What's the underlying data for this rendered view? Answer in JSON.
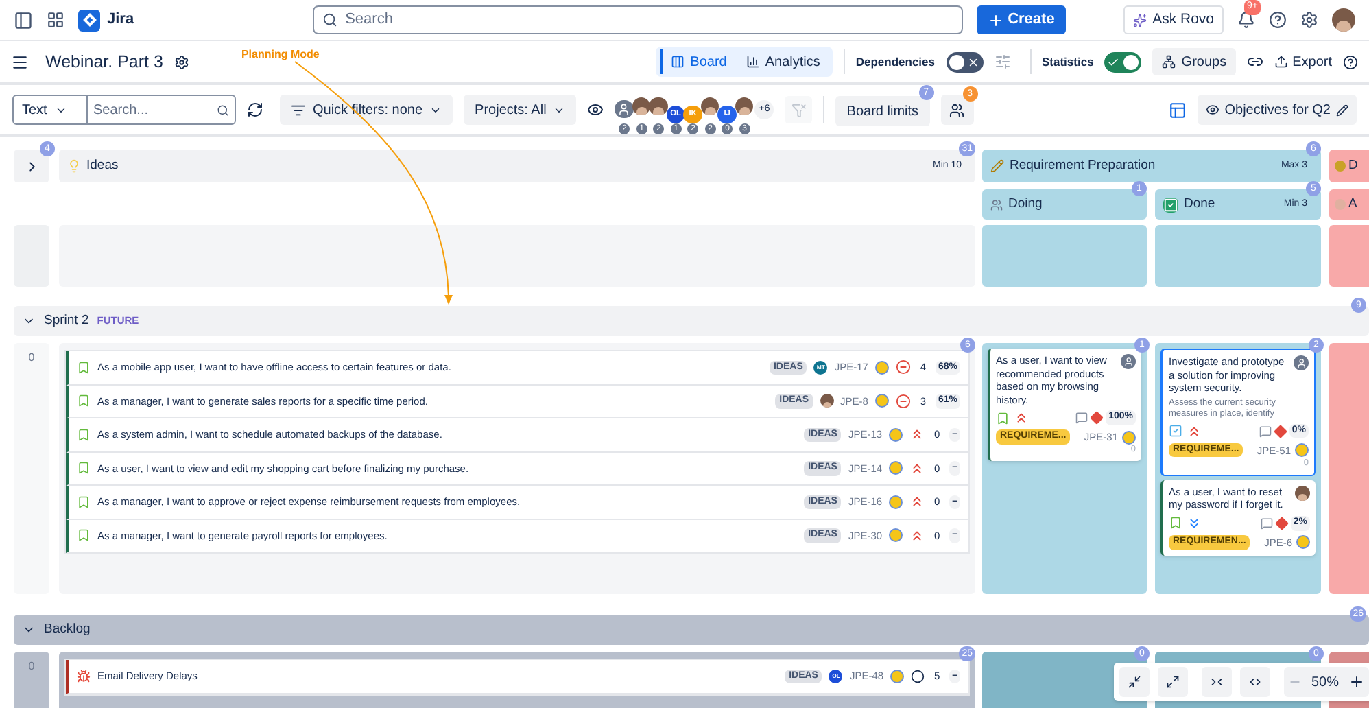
{
  "topbar": {
    "app_name": "Jira",
    "search": {
      "placeholder": "Search"
    },
    "create": "Create",
    "ask_rovo": "Ask Rovo",
    "notifications_badge": "9+"
  },
  "header": {
    "title": "Webinar. Part 3",
    "annotation": "Planning Mode",
    "view_tabs": [
      {
        "label": "Board",
        "selected": true
      },
      {
        "label": "Analytics",
        "selected": false
      }
    ],
    "dependencies": {
      "label": "Dependencies",
      "on": false
    },
    "statistics": {
      "label": "Statistics",
      "on": true
    },
    "groups": "Groups",
    "export": "Export"
  },
  "toolbar": {
    "search_mode": "Text",
    "search": {
      "placeholder": "Search..."
    },
    "quick_filters": "Quick filters: none",
    "projects": "Projects: All",
    "people": [
      {
        "kind": "generic",
        "count": "2"
      },
      {
        "kind": "photo",
        "count": "1"
      },
      {
        "kind": "photo",
        "count": "2"
      },
      {
        "kind": "initials",
        "initials": "OL",
        "color": "#1d4ed8",
        "count": "1"
      },
      {
        "kind": "initials",
        "initials": "IK",
        "color": "#f59e0b",
        "count": "2"
      },
      {
        "kind": "photo",
        "count": "2"
      },
      {
        "kind": "initials",
        "initials": "IJ",
        "color": "#2563eb",
        "count": "0"
      },
      {
        "kind": "photo",
        "count": "3"
      }
    ],
    "more_people": "+6",
    "board_limits": {
      "label": "Board limits",
      "badge": "7"
    },
    "team_badge": "3",
    "objectives": "Objectives for Q2"
  },
  "board": {
    "ideas": {
      "count_badge": "4",
      "title": "Ideas",
      "limit": "Min 10",
      "badge": "31"
    },
    "group": {
      "title": "Requirement Preparation",
      "limit": "Max 3",
      "badge": "6",
      "columns": [
        {
          "kind": "in_progress",
          "title": "Doing",
          "badge": "1"
        },
        {
          "kind": "done",
          "title": "Done",
          "limit": "Min 3",
          "badge": "5"
        }
      ]
    },
    "next_group": {
      "title": "D",
      "columns": [
        {
          "title": "A"
        }
      ]
    },
    "lanes": [
      {
        "kind": "sprint",
        "title": "Sprint 2",
        "state": "FUTURE",
        "expanded": true,
        "badge": "9",
        "row_count": "0",
        "list_badge": "6",
        "column_badges": [
          "1",
          "2"
        ],
        "issues": [
          {
            "kind": "story",
            "summary": "As a mobile app user, I want to have offline access to certain features or data.",
            "tag": "IDEAS",
            "assignee": {
              "kind": "initials",
              "initials": "MT",
              "color": "#0e7490"
            },
            "key": "JPE-17",
            "priority": {
              "kind": "blocker"
            },
            "points": "4",
            "progress": "68%"
          },
          {
            "kind": "story",
            "summary": "As a manager, I want to generate sales reports for a specific time period.",
            "tag": "IDEAS",
            "assignee": {
              "kind": "photo"
            },
            "key": "JPE-8",
            "priority": {
              "kind": "blocker"
            },
            "points": "3",
            "progress": "61%"
          },
          {
            "kind": "story",
            "summary": "As a system admin, I want to schedule automated backups of the database.",
            "tag": "IDEAS",
            "key": "JPE-13",
            "priority": {
              "kind": "highest"
            },
            "points": "0",
            "progress": "–"
          },
          {
            "kind": "story",
            "summary": "As a user, I want to view and edit my shopping cart before finalizing my purchase.",
            "tag": "IDEAS",
            "key": "JPE-14",
            "priority": {
              "kind": "highest"
            },
            "points": "0",
            "progress": "–"
          },
          {
            "kind": "story",
            "summary": "As a manager, I want to approve or reject expense reimbursement requests from employees.",
            "tag": "IDEAS",
            "key": "JPE-16",
            "priority": {
              "kind": "highest"
            },
            "points": "0",
            "progress": "–"
          },
          {
            "kind": "story",
            "summary": "As a manager, I want to generate payroll reports for employees.",
            "tag": "IDEAS",
            "key": "JPE-30",
            "priority": {
              "kind": "highest"
            },
            "points": "0",
            "progress": "–"
          }
        ],
        "columns": [
          [
            {
              "kind": "story",
              "summary": "As a user, I want to view recommended products based on my browsing history.",
              "assignee": {
                "kind": "generic"
              },
              "priority": {
                "kind": "highest"
              },
              "progress": "100%",
              "tag": "REQUIREME...",
              "key": "JPE-31",
              "points": "0",
              "selected": false
            }
          ],
          [
            {
              "kind": "task",
              "summary": "Investigate and prototype a solution for improving system security.",
              "description": "Assess the current security measures in place, identify",
              "assignee": {
                "kind": "generic"
              },
              "priority": {
                "kind": "highest"
              },
              "progress": "0%",
              "tag": "REQUIREME...",
              "key": "JPE-51",
              "points": "0",
              "selected": true
            },
            {
              "kind": "story",
              "summary": "As a user, I want to reset my password if I forget it.",
              "assignee": {
                "kind": "photo"
              },
              "priority": {
                "kind": "lowest"
              },
              "progress": "2%",
              "tag": "REQUIREMEN...",
              "key": "JPE-6",
              "selected": false
            }
          ]
        ]
      },
      {
        "kind": "backlog",
        "title": "Backlog",
        "expanded": true,
        "badge": "26",
        "row_count": "0",
        "list_badge": "25",
        "column_badges": [
          "0",
          "0"
        ],
        "issues": [
          {
            "kind": "bug",
            "summary": "Email Delivery Delays",
            "tag": "IDEAS",
            "assignee": {
              "kind": "initials",
              "initials": "OL",
              "color": "#1d4ed8"
            },
            "key": "JPE-48",
            "priority": {
              "kind": "open"
            },
            "points": "5",
            "progress": "–"
          }
        ],
        "columns": [
          [],
          []
        ]
      }
    ]
  },
  "zoom": {
    "level": "50%"
  }
}
